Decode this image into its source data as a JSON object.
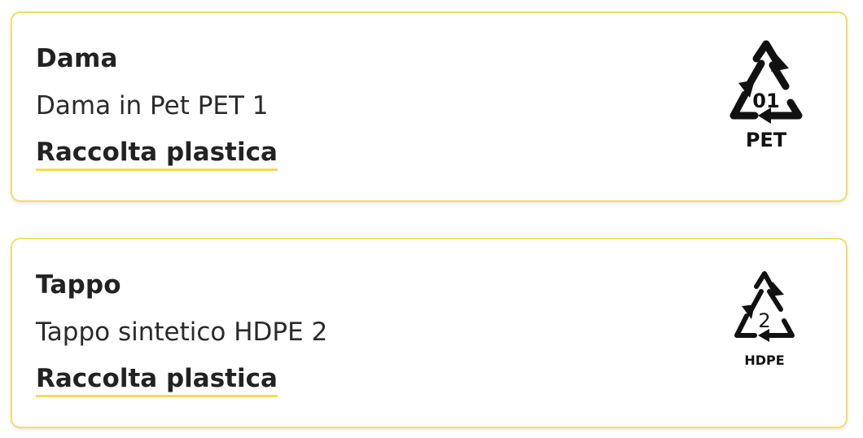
{
  "items": [
    {
      "title": "Dama",
      "description": "Dama in Pet PET 1",
      "link_label": "Raccolta plastica",
      "recycle_code": "01",
      "material": "PET"
    },
    {
      "title": "Tappo",
      "description": "Tappo sintetico HDPE 2",
      "link_label": "Raccolta plastica",
      "recycle_code": "2",
      "material": "HDPE"
    }
  ],
  "colors": {
    "card_border": "#f0df6a",
    "link_underline": "#f2dc55",
    "text": "#222222"
  },
  "icons": [
    "recycle-triangle-icon"
  ]
}
